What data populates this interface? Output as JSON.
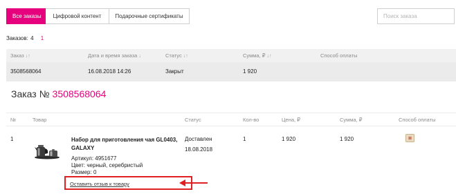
{
  "tabs": [
    {
      "label": "Все заказы",
      "active": true
    },
    {
      "label": "Цифровой контент",
      "active": false
    },
    {
      "label": "Подарочные сертификаты",
      "active": false
    }
  ],
  "search": {
    "placeholder": "Поиск заказа"
  },
  "orders_count": {
    "label": "Заказов:",
    "value": "4",
    "page": "1"
  },
  "orders_table": {
    "headers": {
      "order": "Заказ",
      "date": "Дата и время заказа",
      "status": "Статус",
      "sum": "Сумма, ₽",
      "payment": "Способ оплаты"
    },
    "sort_icons": {
      "order": "↓↑",
      "date": "↓",
      "status": "↓↑",
      "sum": "↓↑"
    },
    "rows": [
      {
        "order": "3508568064",
        "date": "16.08.2018 14:26",
        "status": "Закрыт",
        "sum": "1 920"
      }
    ]
  },
  "order_detail": {
    "title_prefix": "Заказ №",
    "number": "3508568064",
    "headers": {
      "no": "№",
      "product": "Товар",
      "status": "Статус",
      "qty": "Кол-во",
      "price": "Цена, ₽",
      "sum": "Сумма, ₽",
      "payment": "Способ оплаты"
    },
    "items": [
      {
        "no": "1",
        "name": "Набор для приготовления чая GL0403, GALAXY",
        "article": "Артикул:  4951677",
        "color": "Цвет:  черный, серебристый",
        "size": "Размер:  0",
        "review_link": "Оставить отзыв к товару",
        "status": "Доставлен",
        "status_date": "18.08.2018",
        "qty": "1",
        "price": "1 920",
        "sum": "1 920",
        "payment_icon": "card-payment-icon"
      }
    ]
  },
  "colors": {
    "accent": "#e6007e",
    "highlight": "#e02020"
  }
}
